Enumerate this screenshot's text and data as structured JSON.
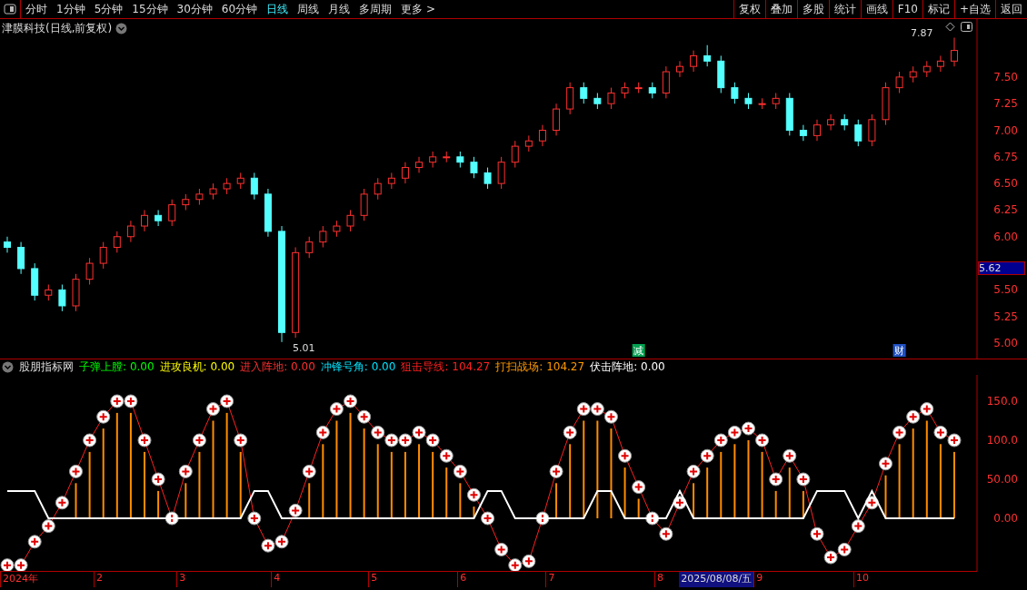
{
  "toolbar": {
    "periods": [
      {
        "label": "分时",
        "selected": false
      },
      {
        "label": "1分钟",
        "selected": false
      },
      {
        "label": "5分钟",
        "selected": false
      },
      {
        "label": "15分钟",
        "selected": false
      },
      {
        "label": "30分钟",
        "selected": false
      },
      {
        "label": "60分钟",
        "selected": false
      },
      {
        "label": "日线",
        "selected": true
      },
      {
        "label": "周线",
        "selected": false
      },
      {
        "label": "月线",
        "selected": false
      },
      {
        "label": "多周期",
        "selected": false
      },
      {
        "label": "更多 >",
        "selected": false
      }
    ],
    "buttons": [
      "复权",
      "叠加",
      "多股",
      "统计",
      "画线",
      "F10",
      "标记",
      "+自选",
      "返回"
    ]
  },
  "price_pane": {
    "title": "津膜科技(日线,前复权)",
    "price_tag": "5.62",
    "event_markers": [
      {
        "text": "减",
        "color": "#00a050"
      },
      {
        "text": "财",
        "color": "#2050c0"
      }
    ],
    "chart_data": {
      "type": "candlestick",
      "ylim": [
        4.855,
        8.045
      ],
      "yticks": [
        {
          "value": 5.0,
          "label": "5.00"
        },
        {
          "value": 5.25,
          "label": "5.25"
        },
        {
          "value": 5.5,
          "label": "5.50"
        },
        {
          "value": 6.0,
          "label": "6.00"
        },
        {
          "value": 6.25,
          "label": "6.25"
        },
        {
          "value": 6.5,
          "label": "6.50"
        },
        {
          "value": 6.75,
          "label": "6.75"
        },
        {
          "value": 7.0,
          "label": "7.00"
        },
        {
          "value": 7.25,
          "label": "7.25"
        },
        {
          "value": 7.5,
          "label": "7.50"
        }
      ],
      "ohlc": [
        [
          5.95,
          6.0,
          5.85,
          5.9
        ],
        [
          5.9,
          5.95,
          5.65,
          5.7
        ],
        [
          5.7,
          5.75,
          5.4,
          5.45
        ],
        [
          5.45,
          5.55,
          5.4,
          5.5
        ],
        [
          5.5,
          5.55,
          5.3,
          5.35
        ],
        [
          5.35,
          5.65,
          5.3,
          5.6
        ],
        [
          5.6,
          5.8,
          5.55,
          5.75
        ],
        [
          5.75,
          5.95,
          5.7,
          5.9
        ],
        [
          5.9,
          6.05,
          5.85,
          6.0
        ],
        [
          6.0,
          6.15,
          5.95,
          6.1
        ],
        [
          6.1,
          6.25,
          6.05,
          6.2
        ],
        [
          6.2,
          6.25,
          6.1,
          6.15
        ],
        [
          6.15,
          6.35,
          6.1,
          6.3
        ],
        [
          6.3,
          6.4,
          6.25,
          6.35
        ],
        [
          6.35,
          6.45,
          6.3,
          6.4
        ],
        [
          6.4,
          6.5,
          6.35,
          6.45
        ],
        [
          6.45,
          6.55,
          6.4,
          6.5
        ],
        [
          6.5,
          6.6,
          6.45,
          6.55
        ],
        [
          6.55,
          6.6,
          6.35,
          6.4
        ],
        [
          6.4,
          6.45,
          6.0,
          6.05
        ],
        [
          6.05,
          6.1,
          5.01,
          5.1
        ],
        [
          5.1,
          5.9,
          5.05,
          5.85
        ],
        [
          5.85,
          6.0,
          5.8,
          5.95
        ],
        [
          5.95,
          6.1,
          5.9,
          6.05
        ],
        [
          6.05,
          6.15,
          6.0,
          6.1
        ],
        [
          6.1,
          6.25,
          6.05,
          6.2
        ],
        [
          6.2,
          6.45,
          6.15,
          6.4
        ],
        [
          6.4,
          6.55,
          6.35,
          6.5
        ],
        [
          6.5,
          6.6,
          6.45,
          6.55
        ],
        [
          6.55,
          6.7,
          6.5,
          6.65
        ],
        [
          6.65,
          6.75,
          6.6,
          6.7
        ],
        [
          6.7,
          6.8,
          6.65,
          6.75
        ],
        [
          6.75,
          6.8,
          6.7,
          6.75
        ],
        [
          6.75,
          6.8,
          6.65,
          6.7
        ],
        [
          6.7,
          6.75,
          6.55,
          6.6
        ],
        [
          6.6,
          6.65,
          6.45,
          6.5
        ],
        [
          6.5,
          6.75,
          6.45,
          6.7
        ],
        [
          6.7,
          6.9,
          6.65,
          6.85
        ],
        [
          6.85,
          6.95,
          6.8,
          6.9
        ],
        [
          6.9,
          7.05,
          6.85,
          7.0
        ],
        [
          7.0,
          7.25,
          6.95,
          7.2
        ],
        [
          7.2,
          7.45,
          7.15,
          7.4
        ],
        [
          7.4,
          7.45,
          7.25,
          7.3
        ],
        [
          7.3,
          7.35,
          7.2,
          7.25
        ],
        [
          7.25,
          7.4,
          7.2,
          7.35
        ],
        [
          7.35,
          7.45,
          7.3,
          7.4
        ],
        [
          7.4,
          7.45,
          7.35,
          7.4
        ],
        [
          7.4,
          7.45,
          7.3,
          7.35
        ],
        [
          7.35,
          7.6,
          7.3,
          7.55
        ],
        [
          7.55,
          7.65,
          7.5,
          7.6
        ],
        [
          7.6,
          7.75,
          7.55,
          7.7
        ],
        [
          7.7,
          7.8,
          7.6,
          7.65
        ],
        [
          7.65,
          7.7,
          7.35,
          7.4
        ],
        [
          7.4,
          7.45,
          7.25,
          7.3
        ],
        [
          7.3,
          7.35,
          7.2,
          7.25
        ],
        [
          7.25,
          7.3,
          7.2,
          7.25
        ],
        [
          7.25,
          7.35,
          7.2,
          7.3
        ],
        [
          7.3,
          7.35,
          6.95,
          7.0
        ],
        [
          7.0,
          7.05,
          6.9,
          6.95
        ],
        [
          6.95,
          7.1,
          6.9,
          7.05
        ],
        [
          7.05,
          7.15,
          7.0,
          7.1
        ],
        [
          7.1,
          7.15,
          7.0,
          7.05
        ],
        [
          7.05,
          7.1,
          6.85,
          6.9
        ],
        [
          6.9,
          7.15,
          6.85,
          7.1
        ],
        [
          7.1,
          7.45,
          7.05,
          7.4
        ],
        [
          7.4,
          7.55,
          7.35,
          7.5
        ],
        [
          7.5,
          7.6,
          7.45,
          7.55
        ],
        [
          7.55,
          7.65,
          7.5,
          7.6
        ],
        [
          7.6,
          7.7,
          7.55,
          7.65
        ],
        [
          7.65,
          7.87,
          7.6,
          7.75
        ]
      ],
      "annotations": [
        "7.87",
        "5.01"
      ]
    }
  },
  "indicator_pane": {
    "name": "股朋指标网",
    "legend": [
      {
        "name": "子弹上膛:",
        "value": "0.00",
        "color": "#00ff00"
      },
      {
        "name": "进攻良机:",
        "value": "0.00",
        "color": "#ffff00"
      },
      {
        "name": "进入阵地:",
        "value": "0.00",
        "color": "#ff3030"
      },
      {
        "name": "冲锋号角:",
        "value": "0.00",
        "color": "#00e5ff"
      },
      {
        "name": "狙击导线:",
        "value": "104.27",
        "color": "#ff2020"
      },
      {
        "name": "打扫战场:",
        "value": "104.27",
        "color": "#ff9900"
      },
      {
        "name": "伏击阵地:",
        "value": "0.00",
        "color": "#ffffff"
      }
    ],
    "chart_data": {
      "type": "line",
      "ylim": [
        -67.4,
        183.7
      ],
      "yticks": [
        {
          "value": 0,
          "label": "0.00"
        },
        {
          "value": 50,
          "label": "50.00"
        },
        {
          "value": 100,
          "label": "100.0"
        },
        {
          "value": 150,
          "label": "150.0"
        }
      ],
      "series": [
        {
          "color": "#ff2020",
          "marker": "circle",
          "values": [
            -60,
            -60,
            -30,
            -10,
            20,
            60,
            100,
            130,
            150,
            150,
            100,
            50,
            0,
            60,
            100,
            140,
            150,
            100,
            0,
            -35,
            -30,
            10,
            60,
            110,
            140,
            150,
            130,
            110,
            100,
            100,
            110,
            100,
            80,
            60,
            30,
            0,
            -40,
            -60,
            -55,
            0,
            60,
            110,
            140,
            140,
            130,
            80,
            40,
            0,
            -20,
            20,
            60,
            80,
            100,
            110,
            115,
            100,
            50,
            80,
            50,
            -20,
            -50,
            -40,
            -10,
            20,
            70,
            110,
            130,
            140,
            110,
            100
          ]
        },
        {
          "color": "#ff8c00",
          "type": "bar",
          "values": [
            null,
            null,
            null,
            null,
            null,
            45,
            85,
            115,
            135,
            135,
            85,
            35,
            null,
            45,
            85,
            125,
            135,
            85,
            null,
            null,
            null,
            null,
            45,
            95,
            125,
            135,
            115,
            95,
            85,
            85,
            95,
            85,
            65,
            45,
            15,
            null,
            null,
            null,
            null,
            null,
            45,
            95,
            125,
            125,
            115,
            65,
            25,
            null,
            null,
            null,
            45,
            65,
            85,
            95,
            100,
            85,
            35,
            65,
            35,
            null,
            null,
            null,
            null,
            null,
            55,
            95,
            115,
            125,
            95,
            85
          ]
        },
        {
          "color": "#ffffff",
          "marker": "none",
          "values": [
            35,
            35,
            35,
            0,
            0,
            0,
            0,
            0,
            0,
            0,
            0,
            0,
            0,
            0,
            0,
            0,
            0,
            0,
            35,
            35,
            0,
            0,
            0,
            0,
            0,
            0,
            0,
            0,
            0,
            0,
            0,
            0,
            0,
            0,
            0,
            35,
            35,
            0,
            0,
            0,
            0,
            0,
            0,
            35,
            35,
            0,
            0,
            0,
            0,
            35,
            0,
            0,
            0,
            0,
            0,
            0,
            0,
            0,
            0,
            35,
            35,
            35,
            0,
            35,
            0,
            0,
            0,
            0,
            0,
            0
          ]
        }
      ]
    }
  },
  "x_axis": {
    "labels": [
      "2024年",
      "2",
      "3",
      "4",
      "5",
      "6",
      "7",
      "8"
    ],
    "cursor_date": "2025/08/08/五",
    "labels_after": [
      "9",
      "10"
    ]
  }
}
